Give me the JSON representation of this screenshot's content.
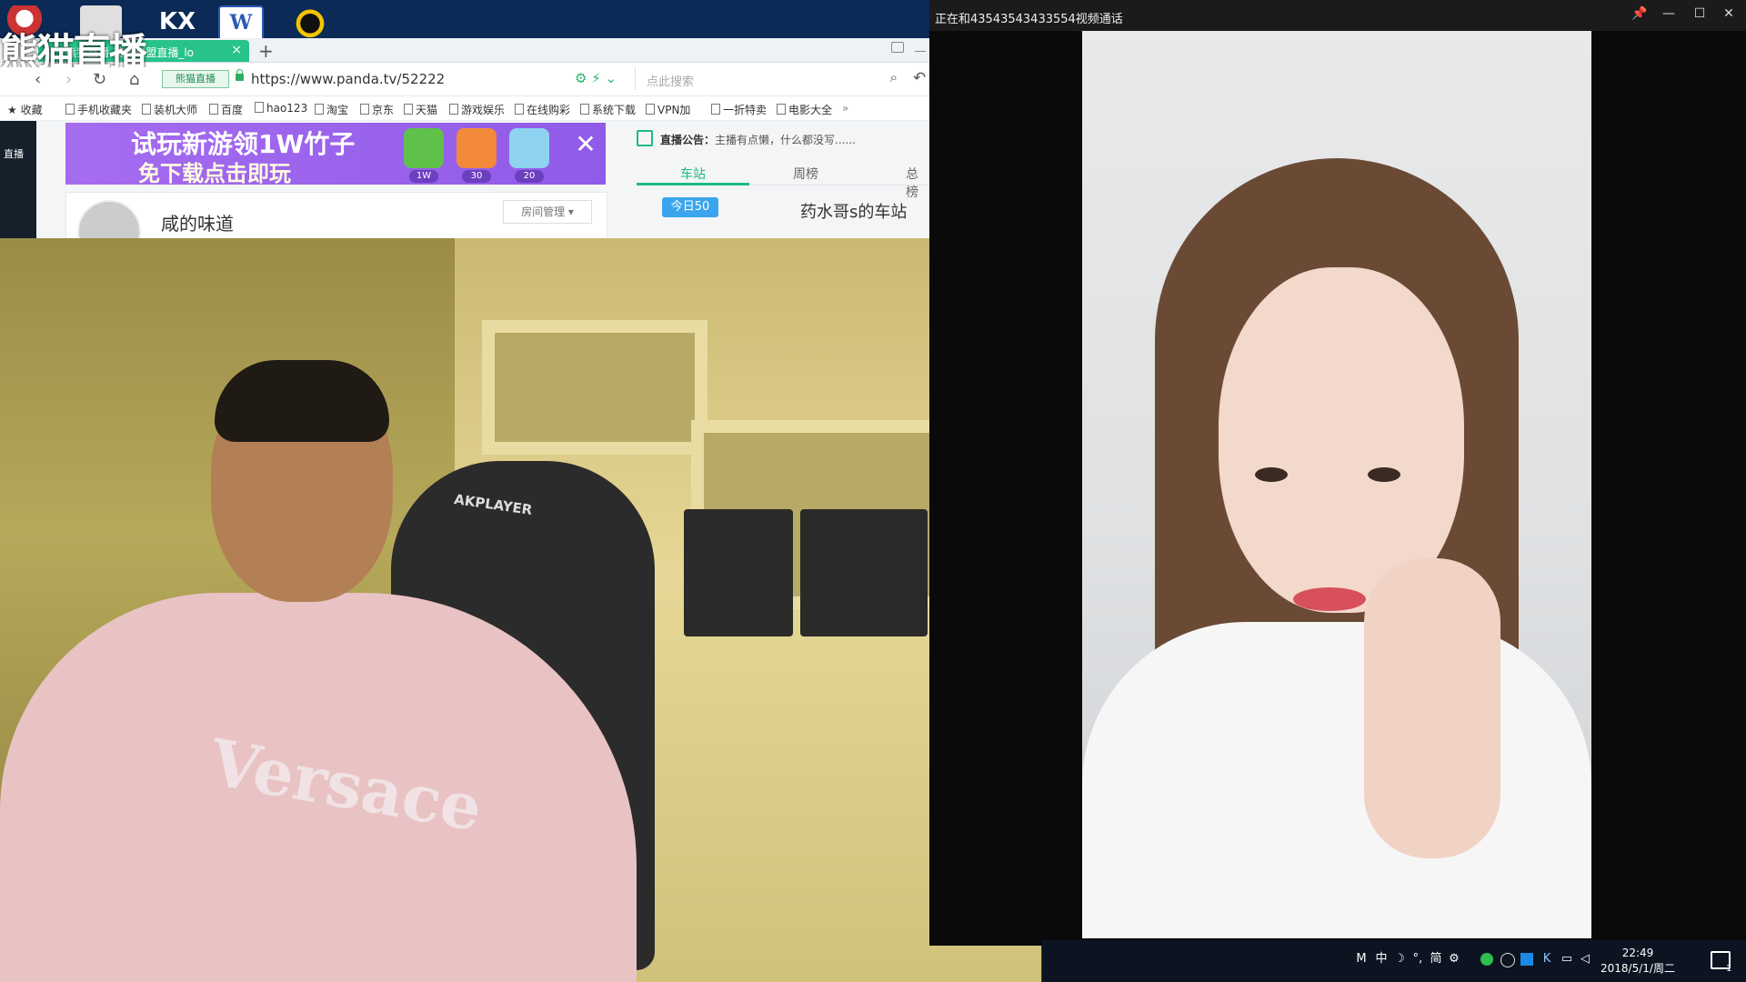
{
  "desktop": {
    "icons": [
      "",
      "",
      "KX",
      "W",
      ""
    ],
    "watermark": "熊猫直播"
  },
  "browser": {
    "tab": {
      "title": "熊猫直播-英雄联盟直播_lo",
      "close": "×"
    },
    "new_tab": "+",
    "nav": {
      "back": "‹",
      "forward": "›",
      "reload": "↻",
      "home": "⌂"
    },
    "site_badge": "熊猫直播",
    "url": "https://www.panda.tv/52222",
    "search_placeholder": "点此搜索",
    "bookmarks": [
      "收藏",
      "手机收藏夹",
      "装机大师",
      "百度",
      "hao123",
      "淘宝",
      "京东",
      "天猫",
      "游戏娱乐",
      "在线购彩",
      "系统下载",
      "VPN加",
      "一折特卖",
      "电影大全"
    ],
    "left_rail_label": "直播",
    "ad": {
      "line1": "试玩新游领1W竹子",
      "line2": "免下载点击即玩",
      "chip1": "1W",
      "chip2": "30",
      "chip3": "20",
      "close": "✕"
    },
    "room": {
      "name": "咸的味道",
      "manage": "房间管理"
    },
    "notice": {
      "label": "直播公告：",
      "text": "主播有点懒，什么都没写......"
    },
    "rank_tabs": [
      "车站",
      "周榜",
      "总榜"
    ],
    "today_badge": "今日50",
    "station_name": "药水哥s的车站"
  },
  "cam_left": {
    "chair_brand": "AKPLAYER",
    "shirt_logo": "Versace"
  },
  "call": {
    "title": "正在和43543543433554视频通话",
    "buttons": [
      "📌",
      "—",
      "☐",
      "✕"
    ]
  },
  "taskbar": {
    "tray": [
      "M",
      "中",
      "☽",
      "°,",
      "简",
      "⚙"
    ],
    "time": "22:49",
    "date": "2018/5/1/周二",
    "notification_count": "1"
  },
  "colors": {
    "accent_green": "#1cbc80",
    "tab_green": "#27c38a",
    "ad_purple": "#9a62ec",
    "badge_blue": "#3aa5ee",
    "taskbar": "#0c1422"
  }
}
